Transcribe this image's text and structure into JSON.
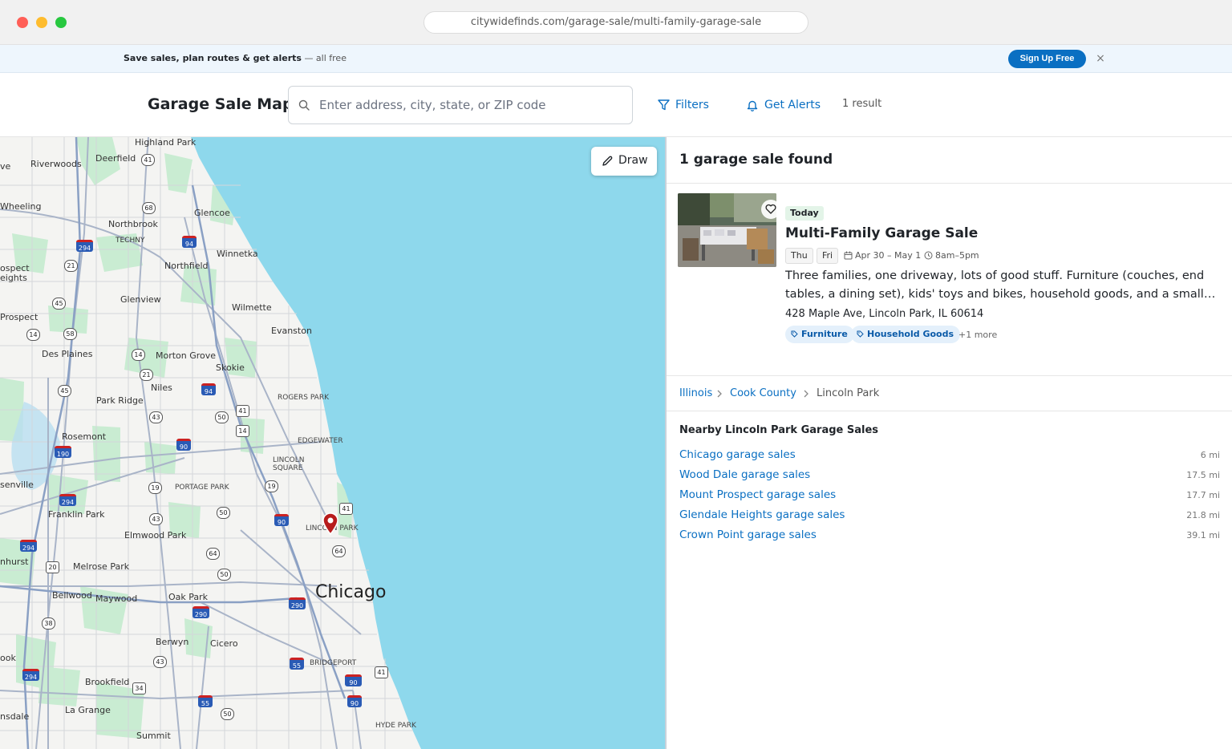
{
  "browser": {
    "url": "citywidefinds.com/garage-sale/multi-family-garage-sale"
  },
  "banner": {
    "bold_text": "Save sales, plan routes & get alerts",
    "rest_text": "— all free",
    "signup_label": "Sign Up Free",
    "close_label": "×"
  },
  "header": {
    "title": "Garage Sale Map",
    "search_placeholder": "Enter address, city, state, or ZIP code",
    "filters_label": "Filters",
    "alerts_label": "Get Alerts",
    "result_count": "1 result"
  },
  "map": {
    "draw_label": "Draw",
    "city_label": "Chicago",
    "places": [
      "Highland Park",
      "Riverwoods",
      "Deerfield",
      "Wheeling",
      "Glencoe",
      "Northbrook",
      "TECHNY",
      "Winnetka",
      "Northfield",
      "ospect",
      "eights",
      "Glenview",
      "Wilmette",
      "Prospect",
      "Evanston",
      "Des Plaines",
      "Morton Grove",
      "Skokie",
      "Niles",
      "Park Ridge",
      "ROGERS PARK",
      "Rosemont",
      "EDGEWATER",
      "LINCOLN",
      "SQUARE",
      "senville",
      "PORTAGE PARK",
      "Franklin Park",
      "Elmwood Park",
      "LINCOLN PARK",
      "nhurst",
      "Melrose Park",
      "Bellwood",
      "Maywood",
      "Oak Park",
      "Berwyn",
      "Cicero",
      "ook",
      "BRIDGEPORT",
      "Brookfield",
      "La Grange",
      "nsdale",
      "Summit",
      "HYDE PARK",
      "ve"
    ],
    "highways": [
      "41",
      "68",
      "94",
      "294",
      "21",
      "45",
      "58",
      "14",
      "14",
      "21",
      "45",
      "94",
      "41",
      "43",
      "50",
      "14",
      "90",
      "190",
      "19",
      "19",
      "294",
      "43",
      "50",
      "90",
      "41",
      "294",
      "64",
      "64",
      "20",
      "50",
      "290",
      "290",
      "38",
      "55",
      "43",
      "294",
      "34",
      "90",
      "41",
      "55",
      "50",
      "90"
    ],
    "pin_color": "#b71c1c",
    "water_color": "#8ed8ec"
  },
  "panel": {
    "found_title": "1 garage sale found",
    "listing": {
      "badge": "Today",
      "title": "Multi-Family Garage Sale",
      "days": [
        "Thu",
        "Fri"
      ],
      "date_range": "Apr 30 – May 1",
      "hours": "8am–5pm",
      "description": "Three families, one driveway, lots of good stuff. Furniture (couches, end tables, a dining set), kids' toys and bikes, household goods, and a small…",
      "address": "428 Maple Ave, Lincoln Park, IL 60614",
      "tags": [
        "Furniture",
        "Household Goods"
      ],
      "more_tags": "+1 more"
    },
    "breadcrumb": {
      "state": "Illinois",
      "county": "Cook County",
      "city": "Lincoln Park"
    },
    "nearby": {
      "title": "Nearby Lincoln Park Garage Sales",
      "items": [
        {
          "label": "Chicago garage sales",
          "distance": "6 mi"
        },
        {
          "label": "Wood Dale garage sales",
          "distance": "17.5 mi"
        },
        {
          "label": "Mount Prospect garage sales",
          "distance": "17.7 mi"
        },
        {
          "label": "Glendale Heights garage sales",
          "distance": "21.8 mi"
        },
        {
          "label": "Crown Point garage sales",
          "distance": "39.1 mi"
        }
      ]
    }
  }
}
